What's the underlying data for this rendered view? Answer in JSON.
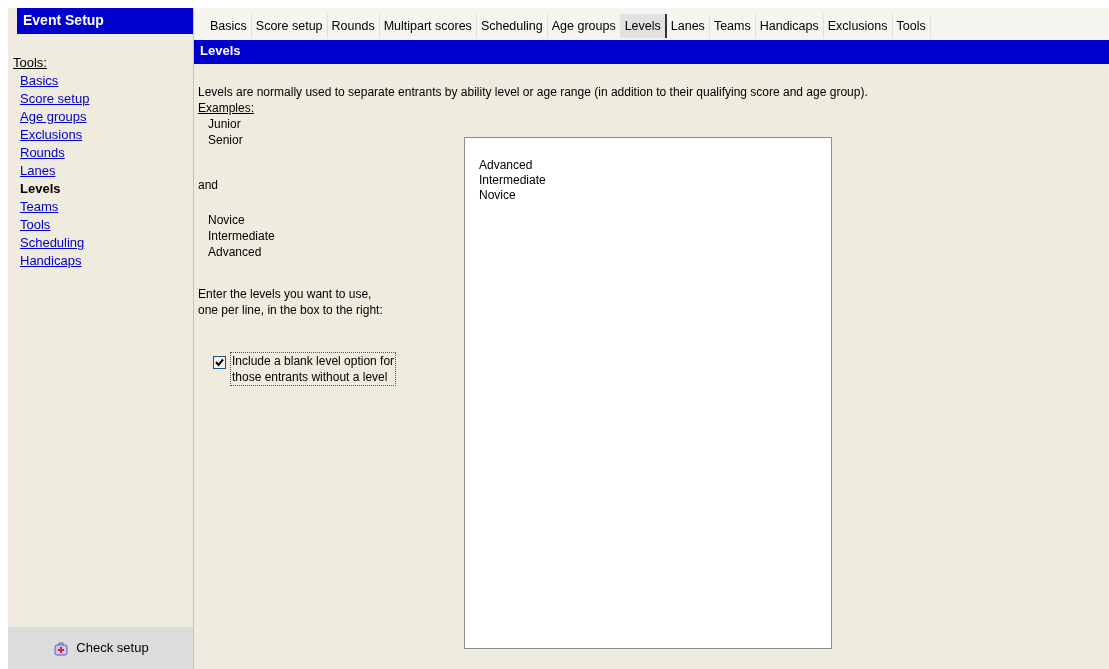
{
  "sidebar": {
    "title": "Event Setup",
    "heading": "Tools:",
    "items": [
      {
        "label": "Basics",
        "selected": false
      },
      {
        "label": "Score setup",
        "selected": false
      },
      {
        "label": "Age groups",
        "selected": false
      },
      {
        "label": "Exclusions",
        "selected": false
      },
      {
        "label": "Rounds",
        "selected": false
      },
      {
        "label": "Lanes",
        "selected": false
      },
      {
        "label": "Levels",
        "selected": true
      },
      {
        "label": "Teams",
        "selected": false
      },
      {
        "label": "Tools",
        "selected": false
      },
      {
        "label": "Scheduling",
        "selected": false
      },
      {
        "label": "Handicaps",
        "selected": false
      }
    ],
    "check_button": "Check setup"
  },
  "tabs": [
    {
      "label": "Basics",
      "selected": false
    },
    {
      "label": "Score setup",
      "selected": false
    },
    {
      "label": "Rounds",
      "selected": false
    },
    {
      "label": "Multipart scores",
      "selected": false
    },
    {
      "label": "Scheduling",
      "selected": false
    },
    {
      "label": "Age groups",
      "selected": false
    },
    {
      "label": "Levels",
      "selected": true
    },
    {
      "label": "Lanes",
      "selected": false
    },
    {
      "label": "Teams",
      "selected": false
    },
    {
      "label": "Handicaps",
      "selected": false
    },
    {
      "label": "Exclusions",
      "selected": false
    },
    {
      "label": "Tools",
      "selected": false
    }
  ],
  "panel": {
    "title": "Levels",
    "description": "Levels are normally used to separate entrants by ability level or age range (in addition to their qualifying score and age group).",
    "examples_heading": "Examples:",
    "examples_a": [
      "Junior",
      "Senior"
    ],
    "joiner": "and",
    "examples_b": [
      "Novice",
      "Intermediate",
      "Advanced"
    ],
    "instructions": "Enter the levels you want to use,\none per line, in the box to the right:",
    "blank_option": {
      "label": "Include a blank level option for\nthose entrants without a level",
      "checked": true
    },
    "levels_text": "Advanced\nIntermediate\nNovice"
  }
}
